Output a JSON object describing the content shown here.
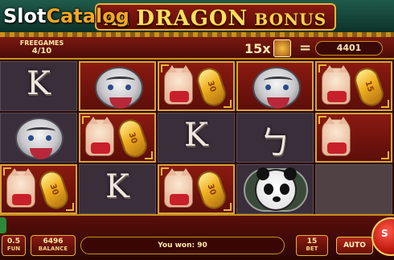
{
  "watermark": {
    "brand_main": "Slot",
    "brand_accent": "Catalog"
  },
  "title": {
    "prefix": "AL",
    "main": "DRAGON",
    "suffix": "BONUS"
  },
  "free_games": {
    "label": "FREEGAMES",
    "count": "4/10"
  },
  "multiplier": {
    "text": "15x",
    "icon": "lucky-cat-coin-icon",
    "equals": "=",
    "total": "4401"
  },
  "reels": {
    "grid": [
      [
        "kanji",
        "tiger",
        "cat-coin",
        "tiger",
        "cat-coin"
      ],
      [
        "tiger",
        "cat-coin",
        "kanji",
        "kanji",
        "cat-coin"
      ],
      [
        "cat-coin",
        "kanji",
        "cat-coin",
        "panda",
        "blank"
      ]
    ],
    "kanji_glyph_1": "K",
    "kanji_glyph_2": "ㄅ",
    "coin_values": {
      "r0c2": "30",
      "r0c4": "15",
      "r1c1": "30",
      "r2c0": "30",
      "r2c2": "30"
    }
  },
  "bottom": {
    "bet_per_line": {
      "value": "0.5",
      "label": "FUN"
    },
    "balance": {
      "value": "6496",
      "label": "BALANCE"
    },
    "win_message": "You won: 90",
    "bet": {
      "value": "15",
      "label": "BET"
    },
    "auto_label": "AUTO",
    "spin_label": "S"
  },
  "colors": {
    "gold": "#e4b43a",
    "red_frame": "#8a1a10",
    "roof_green": "#1f5a4a"
  }
}
